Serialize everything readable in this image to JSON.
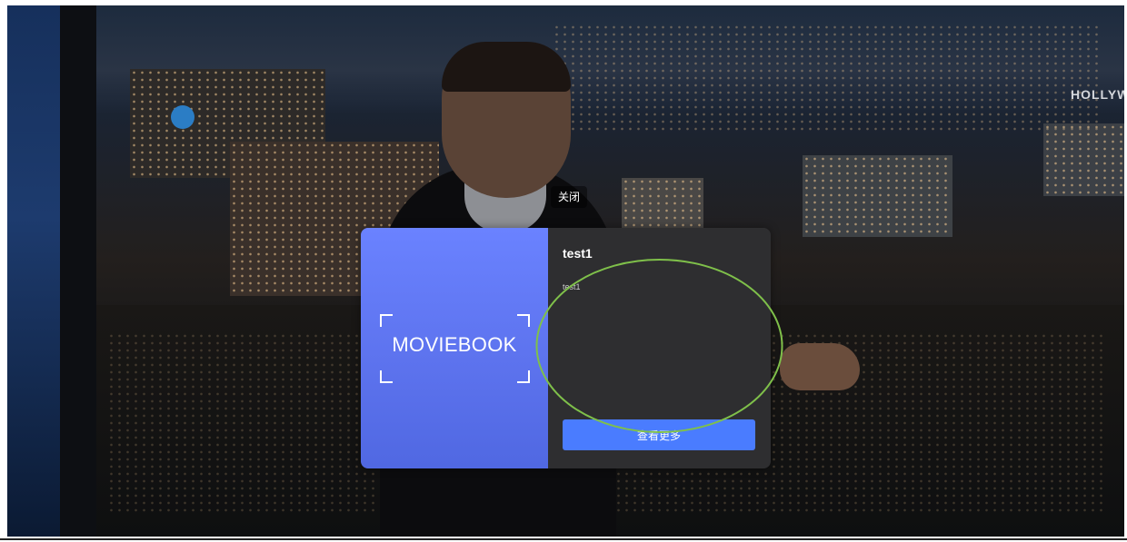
{
  "player": {
    "overlay_sign_text": "HOLLYW"
  },
  "close_label": "关闭",
  "ad_card": {
    "brand_text": "MOVIEBOOK",
    "brand_colors": [
      "#6a82ff",
      "#5068e2"
    ],
    "title": "test1",
    "description": "test1",
    "more_button_label": "查看更多",
    "panel_color": "#2e2e30",
    "button_color": "#4a7cff"
  },
  "annotation": {
    "shape": "ellipse",
    "color": "#7fc04a"
  }
}
